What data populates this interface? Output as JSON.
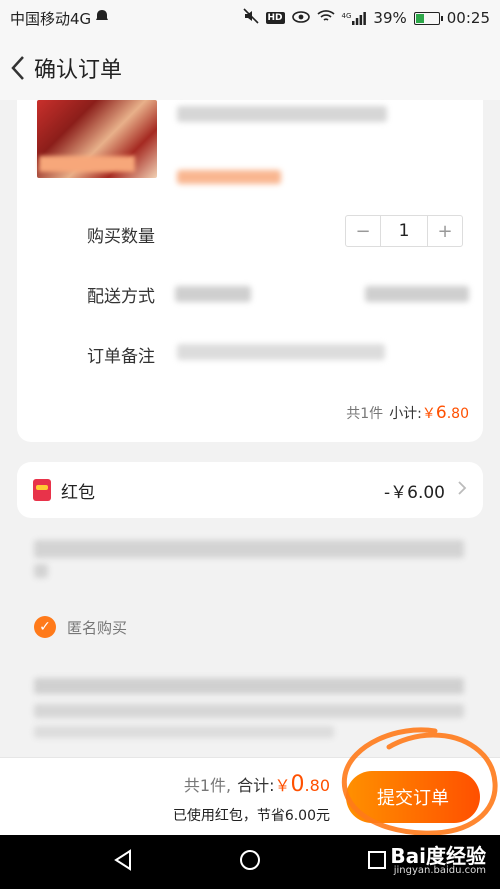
{
  "status": {
    "carrier": "中国移动4G",
    "battery": "39%",
    "battery_level": 0.39,
    "time": "00:25",
    "hd": "HD",
    "net": "4G"
  },
  "nav": {
    "title": "确认订单"
  },
  "order": {
    "quantity_label": "购买数量",
    "quantity": "1",
    "minus": "−",
    "plus": "+",
    "delivery_label": "配送方式",
    "note_label": "订单备注",
    "count": "共1件",
    "subtotal_label": "小计:",
    "subtotal_currency": "￥",
    "subtotal_int": "6",
    "subtotal_dec": ".80"
  },
  "redpacket": {
    "label": "红包",
    "value": "-￥6.00"
  },
  "anonymous": {
    "label": "匿名购买"
  },
  "footer": {
    "count": "共1件,",
    "total_label": "合计:",
    "total_currency": "￥",
    "total_int": "0",
    "total_dec": ".80",
    "save_text": "已使用红包，节省6.00元",
    "submit": "提交订单"
  },
  "watermark": {
    "brand": "Bai度经验",
    "url": "jingyan.baidu.com"
  },
  "colors": {
    "accent": "#ff5000",
    "accent_light": "#ff9000",
    "annotation": "#ff7a1a"
  }
}
